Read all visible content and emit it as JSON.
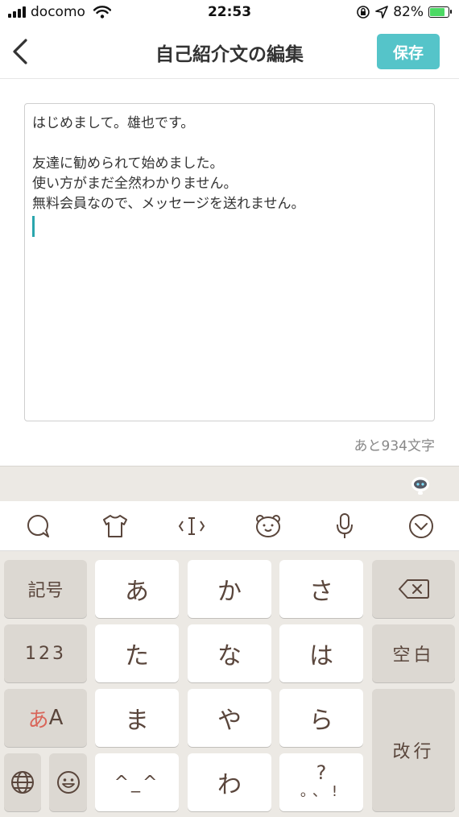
{
  "status_bar": {
    "carrier": "docomo",
    "time": "22:53",
    "battery_percent": "82%",
    "battery_level": 0.82,
    "icons": [
      "signal-icon",
      "wifi-icon",
      "orientation-lock-icon",
      "location-icon",
      "battery-charging-icon"
    ]
  },
  "nav": {
    "title": "自己紹介文の編集",
    "save_label": "保存",
    "back_icon": "chevron-left-icon",
    "accent_color": "#55c4c9"
  },
  "editor": {
    "lines": [
      "はじめまして。雄也です。",
      "",
      "友達に勧められて始めました。",
      "使い方がまだ全然わかりません。",
      "無料会員なので、メッセージを送れません。"
    ],
    "counter": "あと934文字"
  },
  "keyboard": {
    "toolbar": [
      "chat-bubble-icon",
      "shirt-icon",
      "cursor-icon",
      "bear-face-icon",
      "microphone-icon",
      "close-keyboard-icon"
    ],
    "keys": {
      "symbols": "記号",
      "numbers": "123",
      "mode_a": "あ",
      "mode_b": "A",
      "a": "あ",
      "ka": "か",
      "sa": "さ",
      "ta": "た",
      "na": "な",
      "ha": "は",
      "ma": "ま",
      "ya": "や",
      "ra": "ら",
      "kaomoji": "^_^",
      "wa": "わ",
      "punct_q": "?",
      "punct_p": "。、!",
      "space": "空白",
      "enter": "改行"
    }
  }
}
